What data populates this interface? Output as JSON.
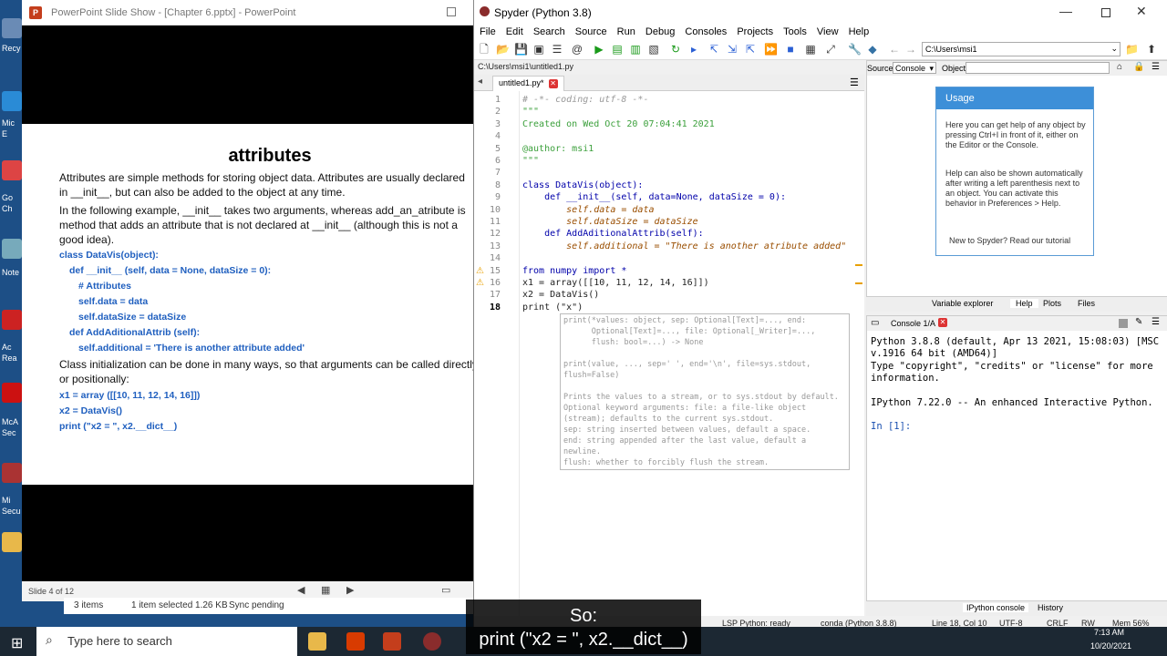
{
  "desktop": {
    "labels": [
      "Recy",
      "Mic",
      "E",
      "Go",
      "Ch",
      "Note",
      "Ac",
      "Rea",
      "McA",
      "Sec",
      "Mi",
      "Secu"
    ]
  },
  "ppt": {
    "title": "PowerPoint Slide Show - [Chapter 6.pptx] - PowerPoint",
    "slide": {
      "heading": "attributes",
      "lines": [
        "Attributes are simple methods for storing object data. Attributes are usually declared",
        "in __init__, but can also be added to the object at any time.",
        "In the following example, __init__ takes two arguments, whereas add_an_atribute is",
        "method that adds an attribute that is not declared at __init__ (although this is not a",
        "good idea).",
        "class DataVis(object):",
        "def __init__ (self, data = None, dataSize = 0):",
        "# Attributes",
        "self.data = data",
        "self.dataSize = dataSize",
        "def AddAditionalAttrib (self):",
        "self.additional = 'There is another attribute added'",
        "Class initialization can be done in many ways, so that arguments can be called directly",
        "or positionally:",
        "x1 = array ([[10, 11, 12, 14, 16]])",
        "x2 = DataVis()",
        "print (\"x2 = \", x2.__dict__)"
      ]
    },
    "status": "Slide 4 of 12"
  },
  "explorer": {
    "items": "3 items",
    "selected": "1 item selected  1.26 KB",
    "sync": "Sync pending"
  },
  "spyder": {
    "title": "Spyder (Python 3.8)",
    "menu": [
      "File",
      "Edit",
      "Search",
      "Source",
      "Run",
      "Debug",
      "Consoles",
      "Projects",
      "Tools",
      "View",
      "Help"
    ],
    "path": "C:\\Users\\msi1",
    "file_path": "C:\\Users\\msi1\\untitled1.py",
    "tab": "untitled1.py*",
    "line_numbers": [
      "1",
      "2",
      "3",
      "4",
      "5",
      "6",
      "7",
      "8",
      "9",
      "10",
      "11",
      "12",
      "13",
      "14",
      "15",
      "16",
      "17",
      "18"
    ],
    "code": [
      "# -*- coding: utf-8 -*-",
      "\"\"\"",
      "Created on Wed Oct 20 07:04:41 2021",
      "",
      "@author: msi1",
      "\"\"\"",
      "",
      "class DataVis(object):",
      "    def __init__(self, data=None, dataSize = 0):",
      "        self.data = data",
      "        self.dataSize = dataSize",
      "    def AddAditionalAttrib(self):",
      "        self.additional = \"There is another atribute added\"",
      "",
      "from numpy import *",
      "x1 = array([[10, 11, 12, 14, 16]])",
      "x2 = DataVis()",
      "print (\"x\")"
    ],
    "calltip": [
      "print(*values: object, sep: Optional[Text]=..., end:",
      "      Optional[Text]=..., file: Optional[_Writer]=...,",
      "      flush: bool=...) -> None",
      "",
      "print(value, ..., sep=' ', end='\\n', file=sys.stdout,",
      "flush=False)",
      "",
      "Prints the values to a stream, or to sys.stdout by default.",
      "Optional keyword arguments: file: a file-like object",
      "(stream); defaults to the current sys.stdout.",
      "sep: string inserted between values, default a space.",
      "end: string appended after the last value, default a",
      "newline.",
      "flush: whether to forcibly flush the stream."
    ],
    "help": {
      "source_label": "Source",
      "source_value": "Console",
      "object_label": "Object",
      "usage_title": "Usage",
      "p1": "Here you can get help of any object by pressing Ctrl+I in front of it, either on the Editor or the Console.",
      "p2": "Help can also be shown automatically after writing a left parenthesis next to an object. You can activate this behavior in Preferences > Help.",
      "p3": "New to Spyder? Read our tutorial"
    },
    "pane_tabs": [
      "Variable explorer",
      "Help",
      "Plots",
      "Files"
    ],
    "console_title": "Console 1/A",
    "console": [
      "Python 3.8.8 (default, Apr 13 2021, 15:08:03) [MSC",
      "v.1916 64 bit (AMD64)]",
      "Type \"copyright\", \"credits\" or \"license\" for more",
      "information.",
      "",
      "IPython 7.22.0 -- An enhanced Interactive Python.",
      "",
      "In [1]:"
    ],
    "console_tabs": [
      "IPython console",
      "History"
    ],
    "status": [
      "LSP Python: ready",
      "conda (Python 3.8.8)",
      "Line 18, Col 10",
      "UTF-8",
      "CRLF",
      "RW",
      "Mem 56%"
    ]
  },
  "taskbar": {
    "search": "Type here to search",
    "time": "7:13 AM",
    "date": "10/20/2021"
  },
  "subtitle": {
    "line1": "So:",
    "line2": "print (\"x2 = \", x2.__dict__)"
  }
}
